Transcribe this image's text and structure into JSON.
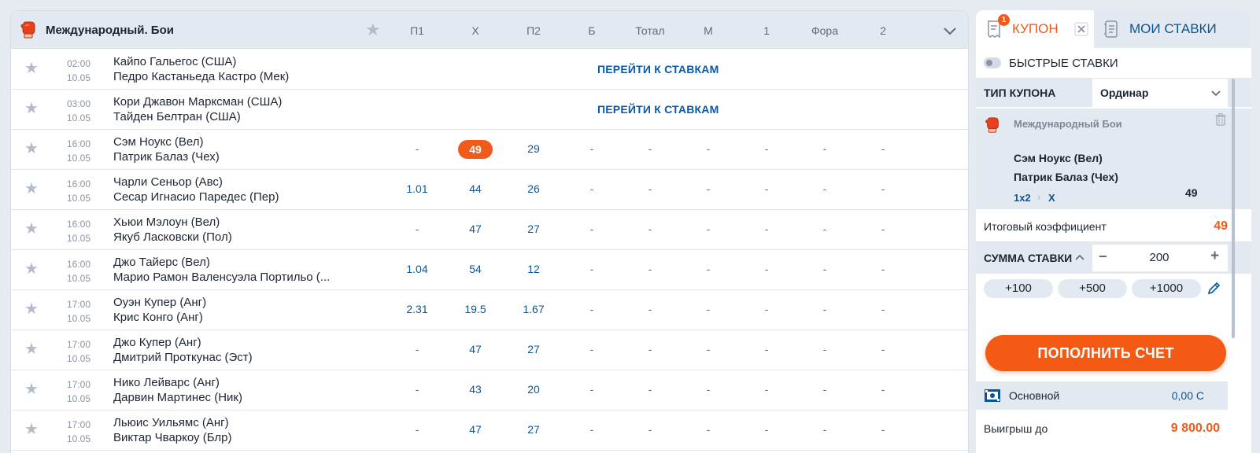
{
  "events": {
    "league": "Международный. Бои",
    "columns": [
      "П1",
      "Х",
      "П2",
      "Б",
      "Тотал",
      "М",
      "1",
      "Фора",
      "2"
    ],
    "rows": [
      {
        "time": "02:00",
        "date": "10.05",
        "team1": "Кайпо Гальегос (США)",
        "team2": "Педро Кастаньеда Кастро (Мек)",
        "goto": "ПЕРЕЙТИ К СТАВКАМ",
        "odds": []
      },
      {
        "time": "03:00",
        "date": "10.05",
        "team1": "Кори Джавон Марксман (США)",
        "team2": "Тайден Белтран (США)",
        "goto": "ПЕРЕЙТИ К СТАВКАМ",
        "odds": []
      },
      {
        "time": "16:00",
        "date": "10.05",
        "team1": "Сэм Ноукс (Вел)",
        "team2": "Патрик Балаз (Чех)",
        "goto": "",
        "odds": [
          "-",
          "49",
          "29",
          "-",
          "-",
          "-",
          "-",
          "-",
          "-"
        ],
        "selected": 1
      },
      {
        "time": "16:00",
        "date": "10.05",
        "team1": "Чарли Сеньор (Авс)",
        "team2": "Сесар Игнасио Паредес (Пер)",
        "goto": "",
        "odds": [
          "1.01",
          "44",
          "26",
          "-",
          "-",
          "-",
          "-",
          "-",
          "-"
        ]
      },
      {
        "time": "16:00",
        "date": "10.05",
        "team1": "Хьюи Мэлоун (Вел)",
        "team2": "Якуб Ласковски (Пол)",
        "goto": "",
        "odds": [
          "-",
          "47",
          "27",
          "-",
          "-",
          "-",
          "-",
          "-",
          "-"
        ]
      },
      {
        "time": "16:00",
        "date": "10.05",
        "team1": "Джо Тайерс (Вел)",
        "team2": "Марио Рамон Валенсуэла Портильо (...",
        "goto": "",
        "odds": [
          "1.04",
          "54",
          "12",
          "-",
          "-",
          "-",
          "-",
          "-",
          "-"
        ]
      },
      {
        "time": "17:00",
        "date": "10.05",
        "team1": "Оуэн Купер (Анг)",
        "team2": "Крис Конго (Анг)",
        "goto": "",
        "odds": [
          "2.31",
          "19.5",
          "1.67",
          "-",
          "-",
          "-",
          "-",
          "-",
          "-"
        ]
      },
      {
        "time": "17:00",
        "date": "10.05",
        "team1": "Джо Купер (Анг)",
        "team2": "Дмитрий Проткунас (Эст)",
        "goto": "",
        "odds": [
          "-",
          "47",
          "27",
          "-",
          "-",
          "-",
          "-",
          "-",
          "-"
        ]
      },
      {
        "time": "17:00",
        "date": "10.05",
        "team1": "Нико Лейварс (Анг)",
        "team2": "Дарвин Мартинес (Ник)",
        "goto": "",
        "odds": [
          "-",
          "43",
          "20",
          "-",
          "-",
          "-",
          "-",
          "-",
          "-"
        ]
      },
      {
        "time": "17:00",
        "date": "10.05",
        "team1": "Льюис Уильямс (Анг)",
        "team2": "Виктар Чваркоу (Блр)",
        "goto": "",
        "odds": [
          "-",
          "47",
          "27",
          "-",
          "-",
          "-",
          "-",
          "-",
          "-"
        ]
      }
    ]
  },
  "coupon": {
    "tab_coupon": "КУПОН",
    "badge": "1",
    "tab_mybets": "МОИ СТАВКИ",
    "quick_bets": "БЫСТРЫЕ СТАВКИ",
    "type_label": "ТИП КУПОНА",
    "type_value": "Ординар",
    "bet": {
      "sport": "Международный Бои",
      "team1": "Сэм Ноукс (Вел)",
      "team2": "Патрик Балаз (Чех)",
      "market": "1x2",
      "outcome": "X",
      "odd": "49"
    },
    "total_label": "Итоговый коэффициент",
    "total_value": "49",
    "stake_label": "СУММА СТАВКИ",
    "stake_value": "200",
    "stake_minus": "−",
    "stake_plus": "+",
    "quick_amounts": [
      "+100",
      "+500",
      "+1000"
    ],
    "topup": "ПОПОЛНИТЬ СЧЕТ",
    "account_label": "Основной",
    "account_value": "0,00 C",
    "win_label": "Выигрыш до",
    "win_value": "9 800.00"
  },
  "colors": {
    "accent": "#f05a1a",
    "link": "#0b5596",
    "panel": "#e3e9f0"
  }
}
